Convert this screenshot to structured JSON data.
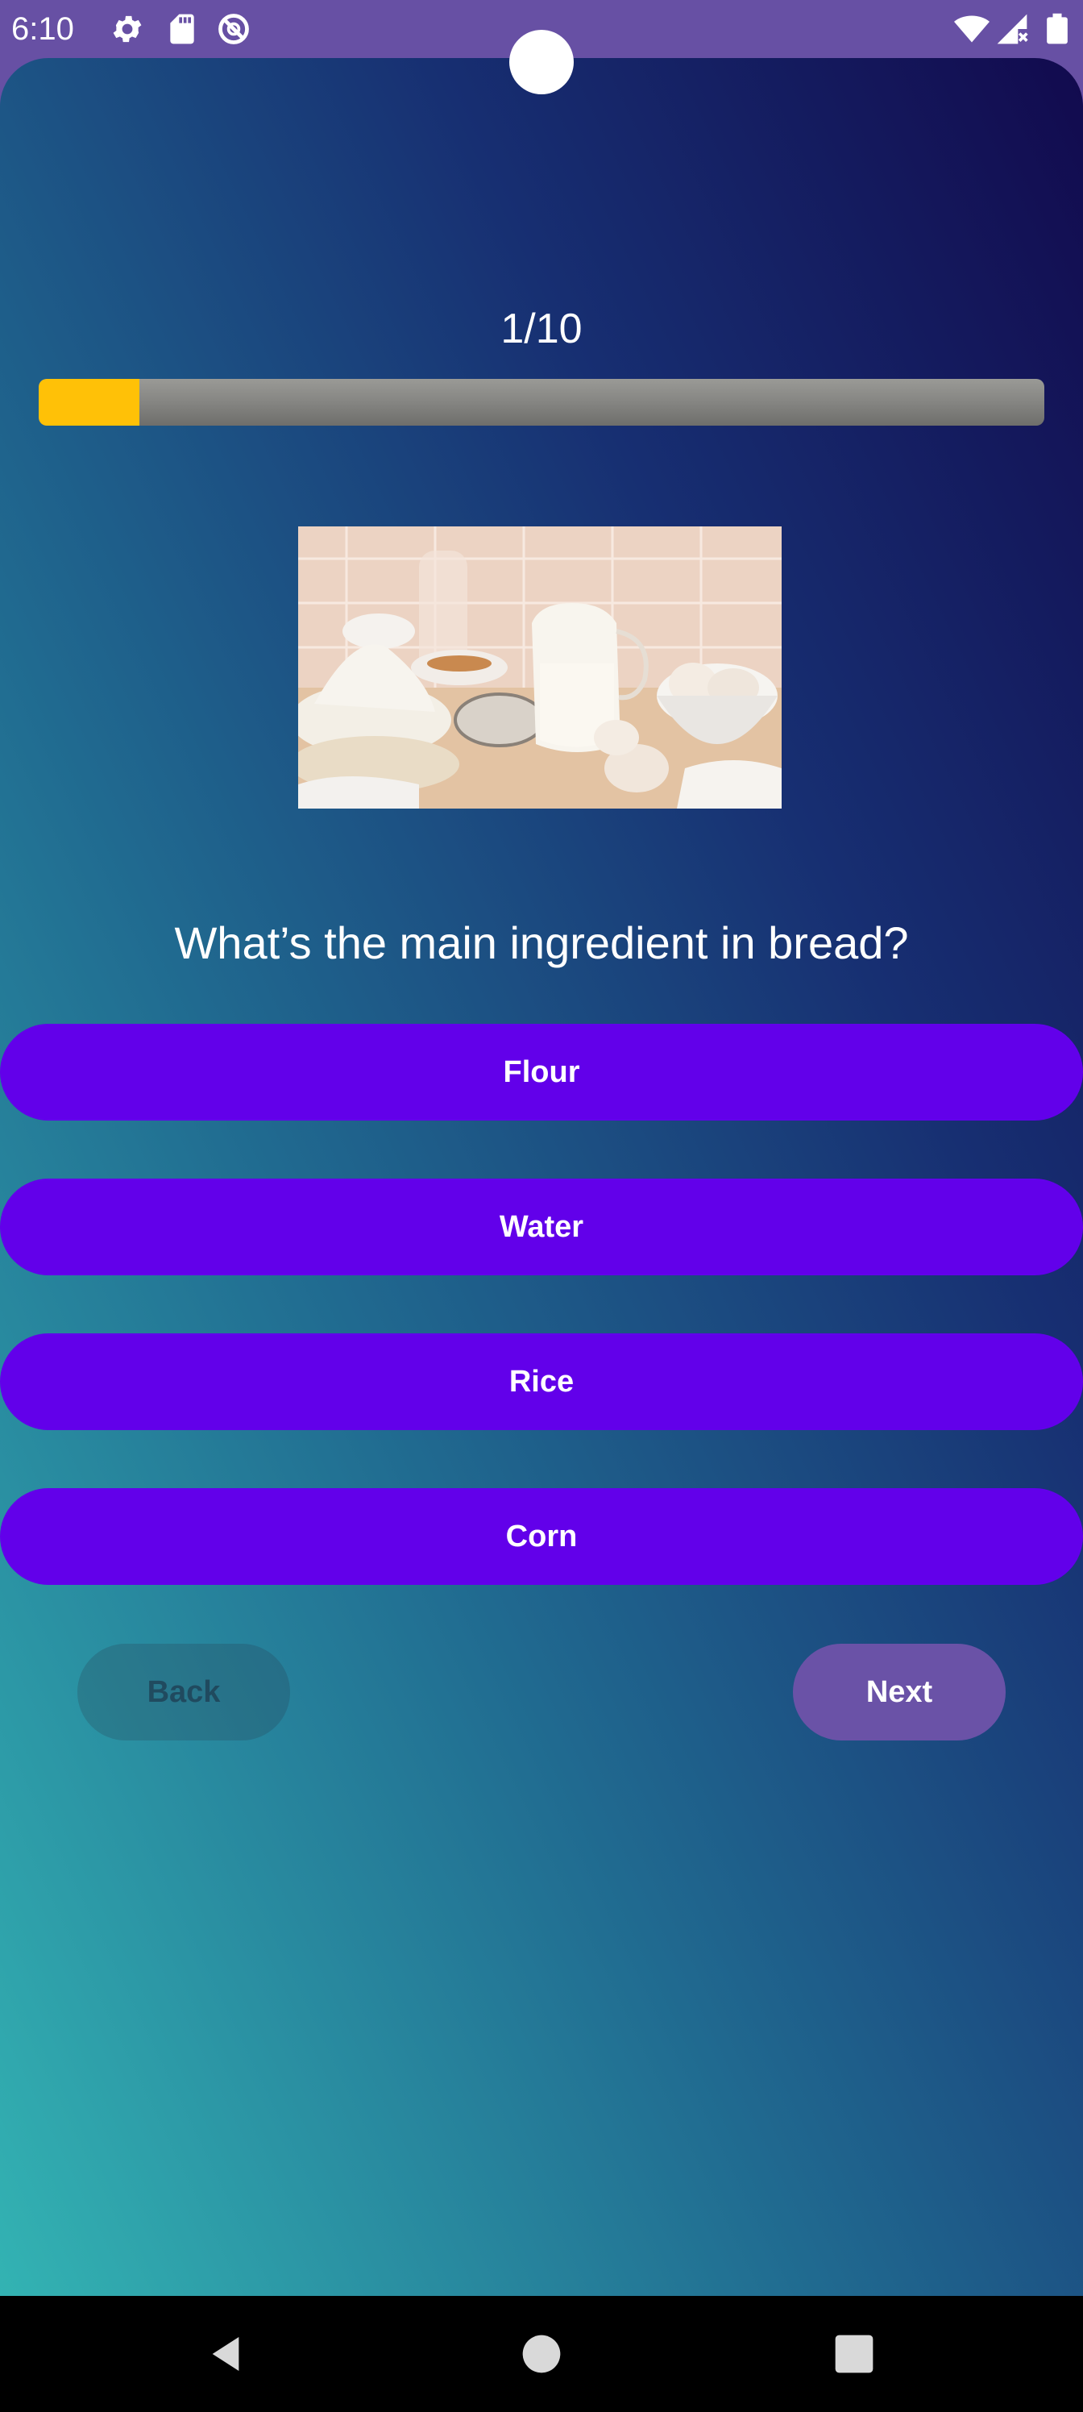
{
  "status_bar": {
    "time": "6:10",
    "icons": [
      "gear-icon",
      "sd-card-icon",
      "do-not-disturb-icon",
      "wifi-icon",
      "signal-no-data-icon",
      "battery-icon"
    ],
    "background": "#6750a4"
  },
  "quiz": {
    "progress_label": "1/10",
    "progress_fraction": 0.1,
    "progress_color": "#ffc107",
    "image_description_icon": "baking-ingredients-photo",
    "question": "What’s the main ingredient in bread?",
    "options": [
      {
        "label": "Flour"
      },
      {
        "label": "Water"
      },
      {
        "label": "Rice"
      },
      {
        "label": "Corn"
      }
    ],
    "option_color": "#6200ea",
    "back_label": "Back",
    "next_label": "Next",
    "next_color": "#6a52a7"
  },
  "nav_bar": {
    "icons": [
      "back-triangle-icon",
      "home-circle-icon",
      "recents-square-icon"
    ]
  }
}
